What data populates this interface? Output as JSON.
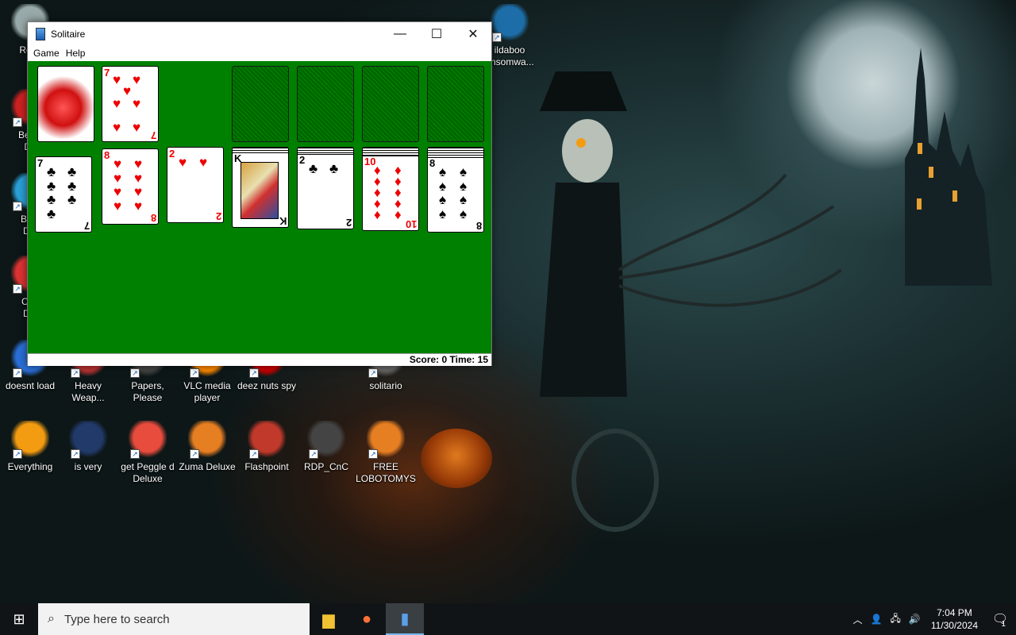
{
  "desktop": {
    "icons": [
      {
        "label": "Recy",
        "name": "recycle-bin"
      },
      {
        "label": "ildaboo\nansomwa...",
        "name": "ildaboo-ransomware"
      },
      {
        "label": "Bejev\nDe",
        "name": "bejeweled-deluxe-1"
      },
      {
        "label": "Beje\nDel",
        "name": "bejeweled-deluxe-2"
      },
      {
        "label": "Chu\nDel",
        "name": "chuzzle-deluxe"
      },
      {
        "label": "doesnt load",
        "name": "doesnt-load"
      },
      {
        "label": "Heavy\nWeap...",
        "name": "heavy-weapon"
      },
      {
        "label": "Papers,\nPlease",
        "name": "papers-please"
      },
      {
        "label": "VLC media\nplayer",
        "name": "vlc-media-player"
      },
      {
        "label": "deez nuts spy",
        "name": "deez-nuts-spy"
      },
      {
        "label": "solitario",
        "name": "solitario"
      },
      {
        "label": "Everything",
        "name": "everything"
      },
      {
        "label": "is very",
        "name": "is-very"
      },
      {
        "label": "get Peggle d\nDeluxe",
        "name": "peggle-deluxe"
      },
      {
        "label": "Zuma Deluxe",
        "name": "zuma-deluxe"
      },
      {
        "label": "Flashpoint",
        "name": "flashpoint"
      },
      {
        "label": "RDP_CnC",
        "name": "rdp-cnc"
      },
      {
        "label": "FREE\nLOBOTOMYS",
        "name": "free-lobotomys"
      }
    ]
  },
  "window": {
    "title": "Solitaire",
    "menu": [
      "Game",
      "Help"
    ],
    "status": "Score: 0 Time: 15"
  },
  "cards": {
    "waste": {
      "rank": "7",
      "suit": "♥"
    },
    "tableau": [
      {
        "rank": "7",
        "suit": "♣",
        "color": "blk"
      },
      {
        "rank": "8",
        "suit": "♥",
        "color": "red"
      },
      {
        "rank": "2",
        "suit": "♥",
        "color": "red"
      },
      {
        "rank": "K",
        "suit": "♠",
        "color": "blk"
      },
      {
        "rank": "2",
        "suit": "♣",
        "color": "blk"
      },
      {
        "rank": "10",
        "suit": "♦",
        "color": "red"
      },
      {
        "rank": "8",
        "suit": "♠",
        "color": "blk"
      }
    ],
    "behind_first": "5"
  },
  "taskbar": {
    "search_placeholder": "Type here to search",
    "time": "7:04 PM",
    "date": "11/30/2024",
    "notification_count": "1"
  },
  "colors": {
    "felt": "#008000",
    "taskbar": "#101416"
  }
}
